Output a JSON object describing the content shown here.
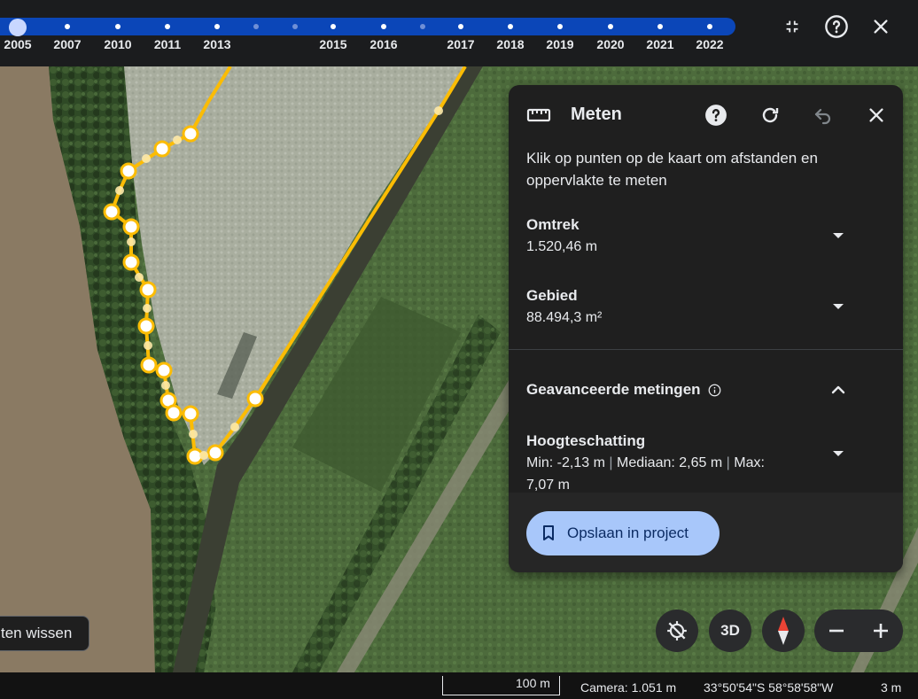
{
  "timeline": {
    "years": [
      "2005",
      "2007",
      "2010",
      "2011",
      "2013",
      "2015",
      "2016",
      "2017",
      "2018",
      "2019",
      "2020",
      "2021",
      "2022"
    ],
    "selected_year": "2005"
  },
  "topbar": {
    "collapse_icon": "collapse-icon",
    "help_icon": "help-circle-icon",
    "close_icon": "close-icon"
  },
  "panel": {
    "title": "Meten",
    "description": "Klik op punten op de kaart om afstanden en oppervlakte te meten",
    "perimeter": {
      "label": "Omtrek",
      "value": "1.520,46 m"
    },
    "area": {
      "label": "Gebied",
      "value": "88.494,3 m²"
    },
    "advanced": {
      "label": "Geavanceerde metingen"
    },
    "elevation": {
      "label": "Hoogteschatting",
      "min": "Min: -2,13 m",
      "sep": "|",
      "median": "Mediaan: 2,65 m",
      "max": "Max:",
      "max_value": "7,07 m"
    },
    "save_label": "Opslaan in project"
  },
  "map": {
    "clear_label": "ten wissen",
    "view_3d_label": "3D",
    "path_color": "#fbbc04"
  },
  "statusbar": {
    "scale": "100 m",
    "camera": "Camera: 1.051 m",
    "coordinates": "33°50'54\"S 58°58'58\"W",
    "elevation": "3 m"
  }
}
